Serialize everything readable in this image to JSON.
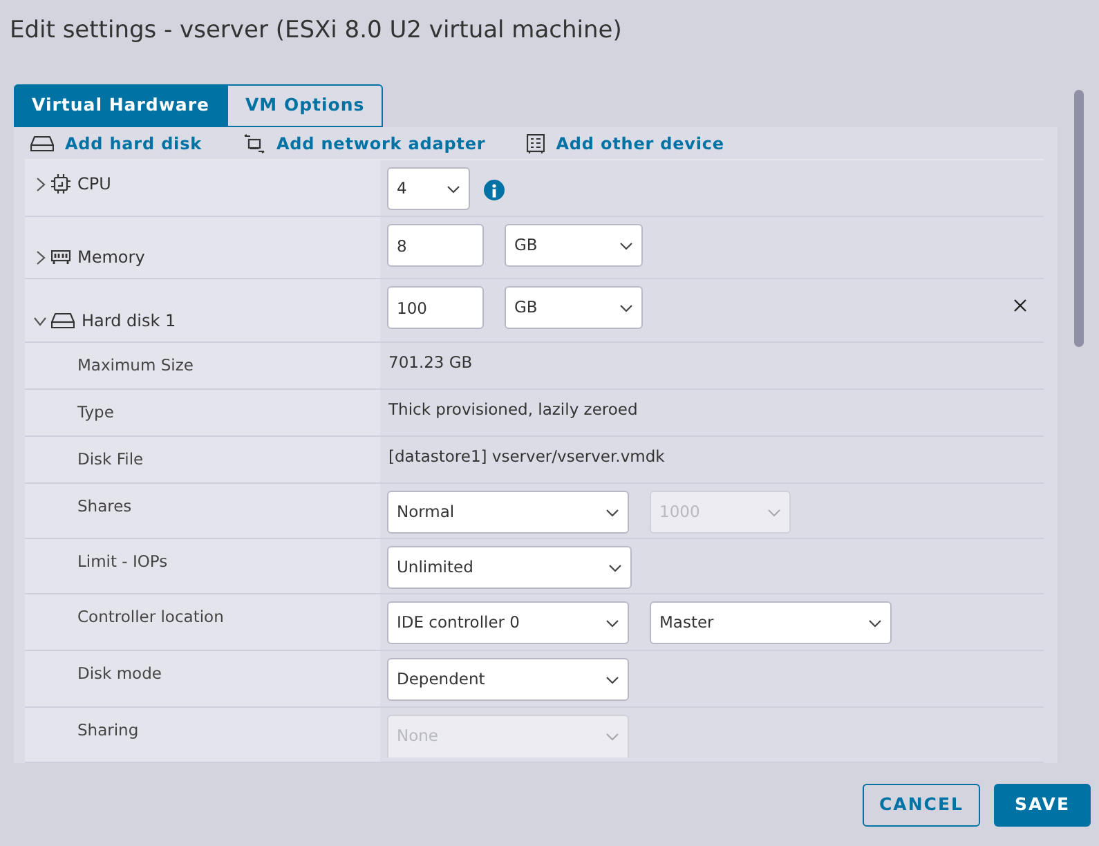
{
  "window": {
    "title": "Edit settings - vserver (ESXi 8.0 U2 virtual machine)"
  },
  "tabs": [
    {
      "label": "Virtual Hardware",
      "selected": true
    },
    {
      "label": "VM Options",
      "selected": false
    }
  ],
  "actions": [
    {
      "kind": "disk",
      "label": "Add hard disk"
    },
    {
      "kind": "network",
      "label": "Add network adapter"
    },
    {
      "kind": "device",
      "label": "Add other device"
    }
  ],
  "rows": [
    {
      "kind": "cpu",
      "label": "CPU",
      "expanded": false,
      "controls": [
        {
          "kind": "select",
          "value": "4",
          "disabled": false
        },
        {
          "kind": "info"
        }
      ]
    },
    {
      "kind": "memory",
      "label": "Memory",
      "expanded": false,
      "controls": [
        {
          "kind": "input",
          "value": "8"
        },
        {
          "kind": "select",
          "value": "GB",
          "disabled": false
        }
      ]
    },
    {
      "kind": "disk",
      "label": "Hard disk 1",
      "expanded": true,
      "removable": true,
      "controls": [
        {
          "kind": "input",
          "value": "100"
        },
        {
          "kind": "select",
          "value": "GB",
          "disabled": false
        }
      ]
    },
    {
      "kind": "property",
      "label": "Maximum Size",
      "controls": [
        {
          "kind": "text",
          "value": "701.23 GB"
        }
      ]
    },
    {
      "kind": "property",
      "label": "Type",
      "controls": [
        {
          "kind": "text",
          "value": "Thick provisioned, lazily zeroed"
        }
      ]
    },
    {
      "kind": "property",
      "label": "Disk File",
      "controls": [
        {
          "kind": "text",
          "value": "[datastore1] vserver/vserver.vmdk"
        }
      ]
    },
    {
      "kind": "property",
      "label": "Shares",
      "controls": [
        {
          "kind": "select",
          "value": "Normal",
          "disabled": false
        },
        {
          "kind": "select",
          "value": "1000",
          "disabled": true
        }
      ]
    },
    {
      "kind": "property",
      "label": "Limit - IOPs",
      "controls": [
        {
          "kind": "select",
          "value": "Unlimited",
          "disabled": false
        }
      ]
    },
    {
      "kind": "property",
      "label": "Controller location",
      "controls": [
        {
          "kind": "select",
          "value": "IDE controller 0",
          "disabled": false
        },
        {
          "kind": "select",
          "value": "Master",
          "disabled": false
        }
      ]
    },
    {
      "kind": "property",
      "label": "Disk mode",
      "controls": [
        {
          "kind": "select",
          "value": "Dependent",
          "disabled": false
        }
      ]
    },
    {
      "kind": "property",
      "label": "Sharing",
      "controls": [
        {
          "kind": "select",
          "value": "None",
          "disabled": true
        }
      ]
    }
  ],
  "buttons": [
    {
      "kind": "secondary",
      "label": "CANCEL"
    },
    {
      "kind": "primary",
      "label": "SAVE"
    }
  ]
}
